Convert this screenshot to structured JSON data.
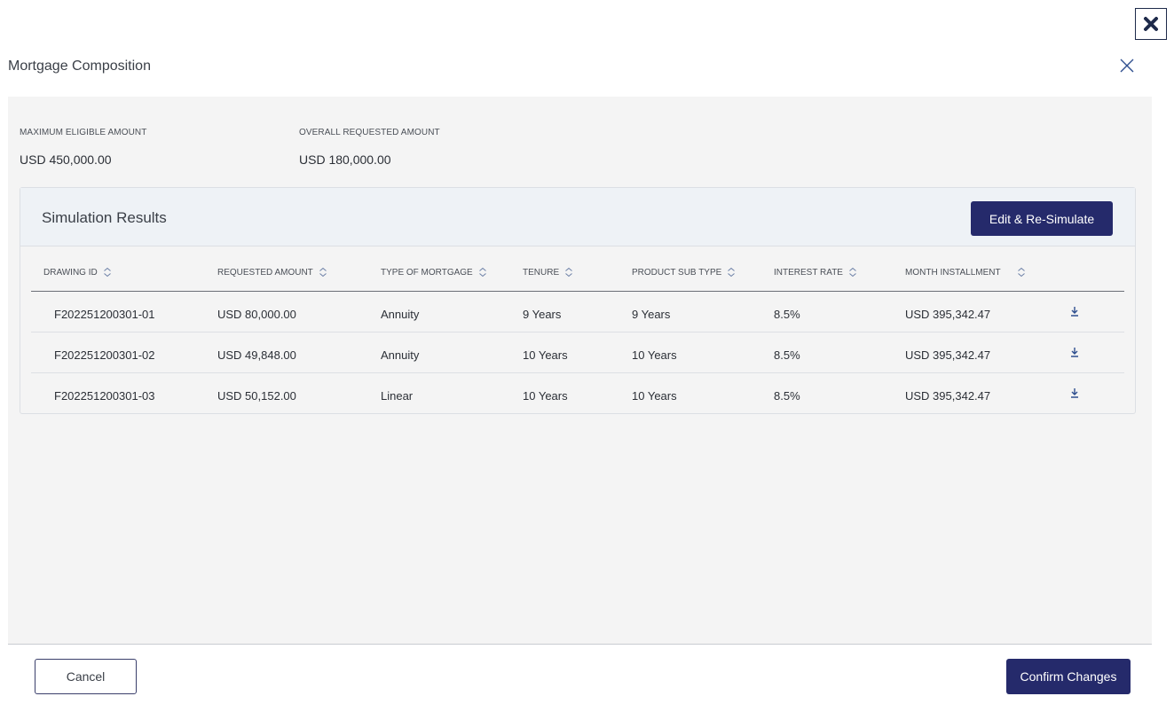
{
  "modal": {
    "title": "Mortgage Composition"
  },
  "summary": {
    "max_label": "MAXIMUM ELIGIBLE AMOUNT",
    "max_value": "USD 450,000.00",
    "requested_label": "OVERALL REQUESTED AMOUNT",
    "requested_value": "USD 180,000.00"
  },
  "results": {
    "title": "Simulation Results",
    "resimulate_label": "Edit & Re-Simulate",
    "columns": [
      "DRAWING ID",
      "REQUESTED AMOUNT",
      "TYPE OF MORTGAGE",
      "TENURE",
      "PRODUCT SUB TYPE",
      "INTEREST RATE",
      "MONTH INSTALLMENT"
    ],
    "rows": [
      [
        "F202251200301-01",
        "USD 80,000.00",
        "Annuity",
        "9 Years",
        "9 Years",
        "8.5%",
        "USD 395,342.47"
      ],
      [
        "F202251200301-02",
        "USD 49,848.00",
        "Annuity",
        "10 Years",
        "10 Years",
        "8.5%",
        "USD 395,342.47"
      ],
      [
        "F202251200301-03",
        "USD 50,152.00",
        "Linear",
        "10 Years",
        "10 Years",
        "8.5%",
        "USD 395,342.47"
      ]
    ]
  },
  "footer": {
    "cancel_label": "Cancel",
    "confirm_label": "Confirm Changes"
  },
  "icons": {
    "top_close": "close-x-bold-icon",
    "modal_close": "close-icon",
    "sort": "sort-icon",
    "download": "download-icon"
  },
  "colors": {
    "primary": "#252a6b",
    "body_bg": "#f4f4f4",
    "header_bg": "#eef2f6",
    "icon_blue": "#2f4f8f"
  }
}
